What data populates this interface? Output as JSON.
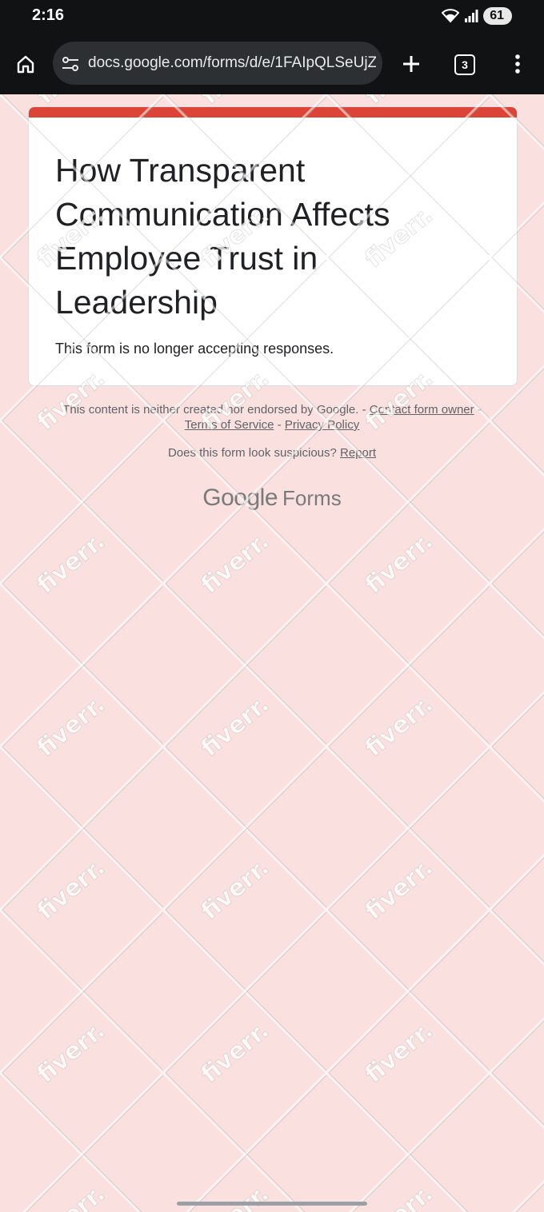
{
  "status_bar": {
    "time": "2:16",
    "battery": "61"
  },
  "browser": {
    "url": "docs.google.com/forms/d/e/1FAIpQLSeUjZvcA",
    "tab_count": "3",
    "icons": [
      "home-icon",
      "site-settings-icon",
      "plus-icon",
      "tab-switcher-icon",
      "more-vert-icon"
    ]
  },
  "form": {
    "title": "How Transparent Communication Affects Employee Trust in Leadership",
    "message": "This form is no longer accepting responses.",
    "accent_color": "#db4437"
  },
  "footer": {
    "disclaimer": "This content is neither created nor endorsed by Google.",
    "sep1": " - ",
    "contact_owner": "Contact form owner",
    "sep2": " -",
    "terms": "Terms of Service",
    "sep3": " - ",
    "privacy": "Privacy Policy",
    "suspicious_question": "Does this form look suspicious? ",
    "report": "Report",
    "brand_google": "Google",
    "brand_forms": "Forms"
  },
  "watermark_text": "fiverr."
}
